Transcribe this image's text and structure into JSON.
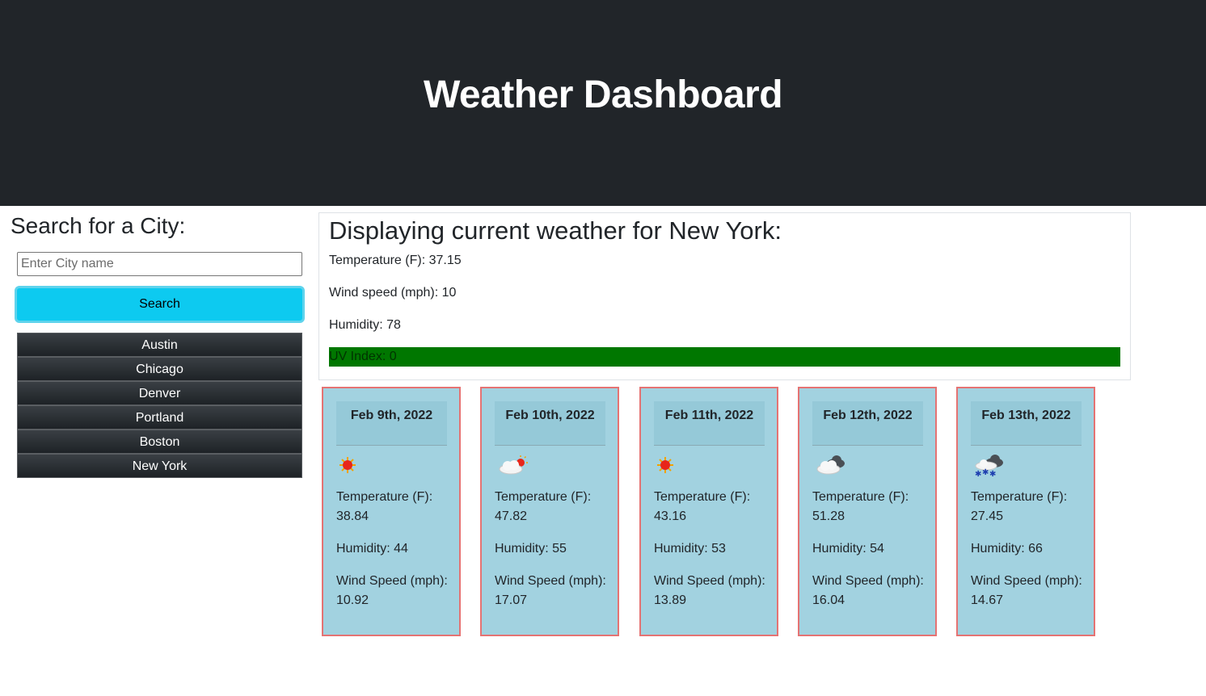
{
  "header": {
    "title": "Weather Dashboard"
  },
  "search": {
    "heading": "Search for a City:",
    "placeholder": "Enter City name",
    "value": "",
    "button_label": "Search"
  },
  "history": [
    "Austin",
    "Chicago",
    "Denver",
    "Portland",
    "Boston",
    "New York"
  ],
  "current": {
    "heading": "Displaying current weather for New York:",
    "temperature": "Temperature (F): 37.15",
    "wind": "Wind speed (mph): 10",
    "humidity": "Humidity: 78",
    "uv": "UV Index: 0",
    "uv_color": "#007700"
  },
  "colors": {
    "header_bg": "#212529",
    "search_button": "#0dcaf0",
    "card_bg": "#a2d2e0",
    "card_border": "#e57373"
  },
  "forecast": [
    {
      "date": "Feb 9th, 2022",
      "icon": "sunny-icon",
      "temperature": "Temperature (F): 38.84",
      "humidity": "Humidity: 44",
      "wind": "Wind Speed (mph): 10.92"
    },
    {
      "date": "Feb 10th, 2022",
      "icon": "partly-cloudy-icon",
      "temperature": "Temperature (F): 47.82",
      "humidity": "Humidity: 55",
      "wind": "Wind Speed (mph): 17.07"
    },
    {
      "date": "Feb 11th, 2022",
      "icon": "sunny-icon",
      "temperature": "Temperature (F): 43.16",
      "humidity": "Humidity: 53",
      "wind": "Wind Speed (mph): 13.89"
    },
    {
      "date": "Feb 12th, 2022",
      "icon": "cloudy-icon",
      "temperature": "Temperature (F): 51.28",
      "humidity": "Humidity: 54",
      "wind": "Wind Speed (mph): 16.04"
    },
    {
      "date": "Feb 13th, 2022",
      "icon": "snow-icon",
      "temperature": "Temperature (F): 27.45",
      "humidity": "Humidity: 66",
      "wind": "Wind Speed (mph): 14.67"
    }
  ]
}
